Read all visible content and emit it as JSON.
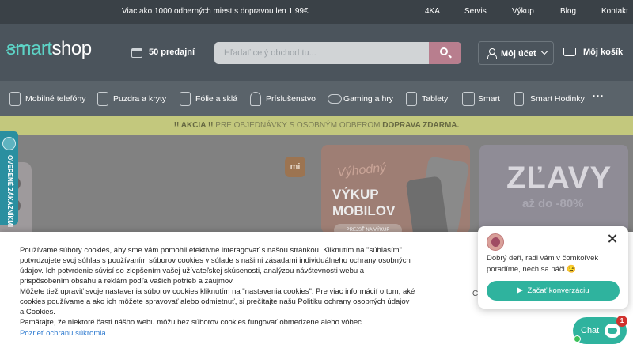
{
  "topbar": {
    "promo": "Viac ako 1000 odberných miest s dopravou len 1,99€",
    "links": [
      "4KA",
      "Servis",
      "Výkup",
      "Blog",
      "Kontakt"
    ]
  },
  "header": {
    "logo_part1": "smart",
    "logo_part2": "shop",
    "stores": "50 predajní",
    "search_placeholder": "Hľadať celý obchod tu...",
    "account": "Môj účet",
    "cart": "Môj košík"
  },
  "categories": [
    "Mobilné telefóny",
    "Puzdra a kryty",
    "Fólie a sklá",
    "Príslušenstvo",
    "Gaming a hry",
    "Tablety",
    "Smart",
    "Smart Hodinky"
  ],
  "more": "···",
  "notice": {
    "prefix": "!! AKCIA !!",
    "text": " PRE OBJEDNÁVKY S OSOBNÝM ODBEROM ",
    "strong": "DOPRAVA ZDARMA."
  },
  "side_badge": "OVERENÉ ZÁKAZNÍKMI",
  "banners": {
    "mi_logo": "mi",
    "vykup_script": "Výhodný",
    "vykup_line1": "VÝKUP",
    "vykup_line2": "MOBILOV",
    "vykup_pill": "PREJSŤ NA VÝKUP",
    "zlavy": "ZĽAVY",
    "zlavy_pct": "až do -80%"
  },
  "cookie": {
    "p1": "Používame súbory cookies, aby sme vám pomohli efektívne interagovať s našou stránkou. Kliknutím na \"súhlasím\" potvrdzujete svoj súhlas s používaním súborov cookies v súlade s našimi zásadami individuálneho ochrany osobných údajov. Ich potvrdenie súvisí so zlepšením vašej užívateľskej skúsenosti, analýzou návštevnosti webu a prispôsobením obsahu a reklám podľa vašich potrieb a záujmov.",
    "p2": "Môžete tiež upraviť svoje nastavenia súborov cookies kliknutím na \"nastavenia cookies\". Pre viac informácií o tom, aké cookies používame a ako ich môžete spravovať alebo odmietnuť, si prečítajte našu Politiku ochrany osobných údajov a Cookies.",
    "p3": "Pamätajte, že niektoré časti nášho webu môžu bez súborov cookies fungovať obmedzene alebo vôbec.",
    "privacy_link": "Pozrieť ochranu súkromia",
    "cut_link": "C"
  },
  "chat": {
    "message": "Dobrý deň, radi vám v čomkoľvek poradíme, nech sa páči 😉",
    "cta": "Začať konverzáciu",
    "button": "Chat",
    "badge": "1"
  }
}
